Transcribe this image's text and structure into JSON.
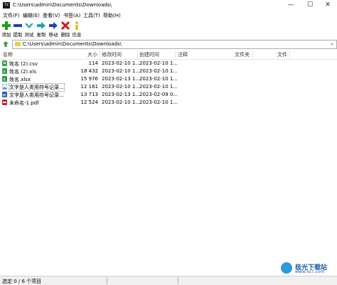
{
  "window": {
    "app_icon_text": "7z",
    "title": "C:\\Users\\admin\\Documents\\Downloads\\",
    "minimize_glyph": "—",
    "maximize_glyph": "☐",
    "close_glyph": "✕"
  },
  "menu": [
    "文件(F)",
    "编辑(E)",
    "查看(V)",
    "书签(A)",
    "工具(T)",
    "帮助(H)"
  ],
  "toolbar": {
    "add": "添加",
    "extract": "提取",
    "test": "测试",
    "copy": "复制",
    "move": "移动",
    "delete": "删除",
    "info": "信息",
    "colors": {
      "add": "#1aa01a",
      "extract": "#1f3fbf",
      "test": "#1aa3b3",
      "copy": "#1aa3b3",
      "move": "#1f3fbf",
      "delete": "#d21919",
      "info": "#e0b000"
    }
  },
  "address": {
    "path": "C:\\Users\\admin\\Documents\\Downloads\\",
    "dropdown_glyph": "⌄"
  },
  "columns": {
    "name": "名称",
    "size": "大小",
    "modified": "修改时间",
    "created": "创建时间",
    "comment": "注释",
    "folders": "文件夹",
    "files": "文件"
  },
  "files": [
    {
      "name": "姓名 (2).csv",
      "size": "114",
      "modified": "2023-02-10 1...",
      "created": "2023-02-10 1...",
      "icon": "csv-icon",
      "color": "#2e9e4a"
    },
    {
      "name": "姓名 (2).xls",
      "size": "18 432",
      "modified": "2023-02-10 1...",
      "created": "2023-02-10 1...",
      "icon": "excel-icon",
      "color": "#2e9e4a"
    },
    {
      "name": "姓名.xlsx",
      "size": "15 976",
      "modified": "2023-02-13 1...",
      "created": "2023-02-10 1...",
      "icon": "excel-icon",
      "color": "#2e9e4a"
    },
    {
      "name": "文字是人类用符号记录...",
      "size": "12 161",
      "modified": "2023-02-10 1...",
      "created": "2023-02-10 1...",
      "icon": "image-icon",
      "color": "#3b78c8"
    },
    {
      "name": "文字是人类用符号记录...",
      "size": "13 713",
      "modified": "2023-02-13 1...",
      "created": "2023-02-09 0...",
      "icon": "word-icon",
      "color": "#2b5eb8"
    },
    {
      "name": "未命名-1.pdf",
      "size": "12 524",
      "modified": "2023-02-10 1...",
      "created": "2023-02-10 1...",
      "icon": "pdf-icon",
      "color": "#c8262b"
    }
  ],
  "status": {
    "selection": "选定 0 / 6 个项目"
  },
  "watermark": {
    "text": "极光下载站",
    "sub": "www.xz7.com"
  }
}
